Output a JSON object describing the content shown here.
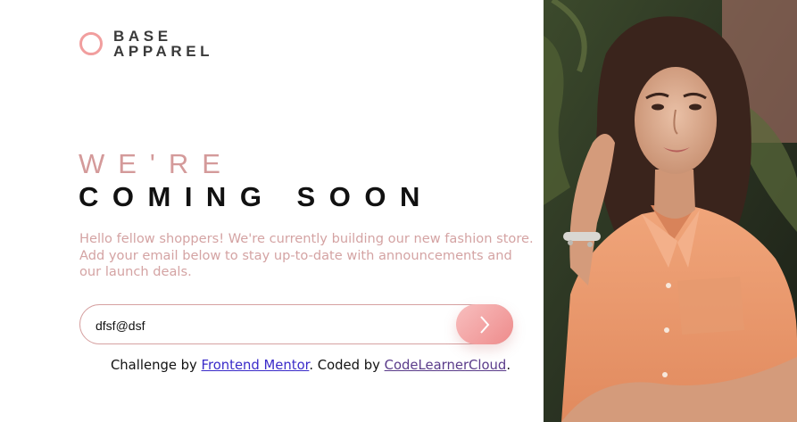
{
  "brand": {
    "line1": "BASE",
    "line2": "APPAREL",
    "accent_color": "#f19e9e"
  },
  "headline": {
    "line1": "WE'RE",
    "line2": "COMING SOON"
  },
  "description": "Hello fellow shoppers! We're currently building our new fashion store. Add your email below to stay up-to-date with announcements and our launch deals.",
  "form": {
    "email_value": "dfsf@dsf",
    "submit_icon": "chevron-right-icon"
  },
  "attribution": {
    "prefix": "Challenge by ",
    "link1": "Frontend Mentor",
    "middle": ". Coded by ",
    "link2": "CodeLearnerCloud",
    "suffix": "."
  },
  "hero_image": {
    "subject": "woman in peach shirt",
    "icon": "hero-photo"
  }
}
